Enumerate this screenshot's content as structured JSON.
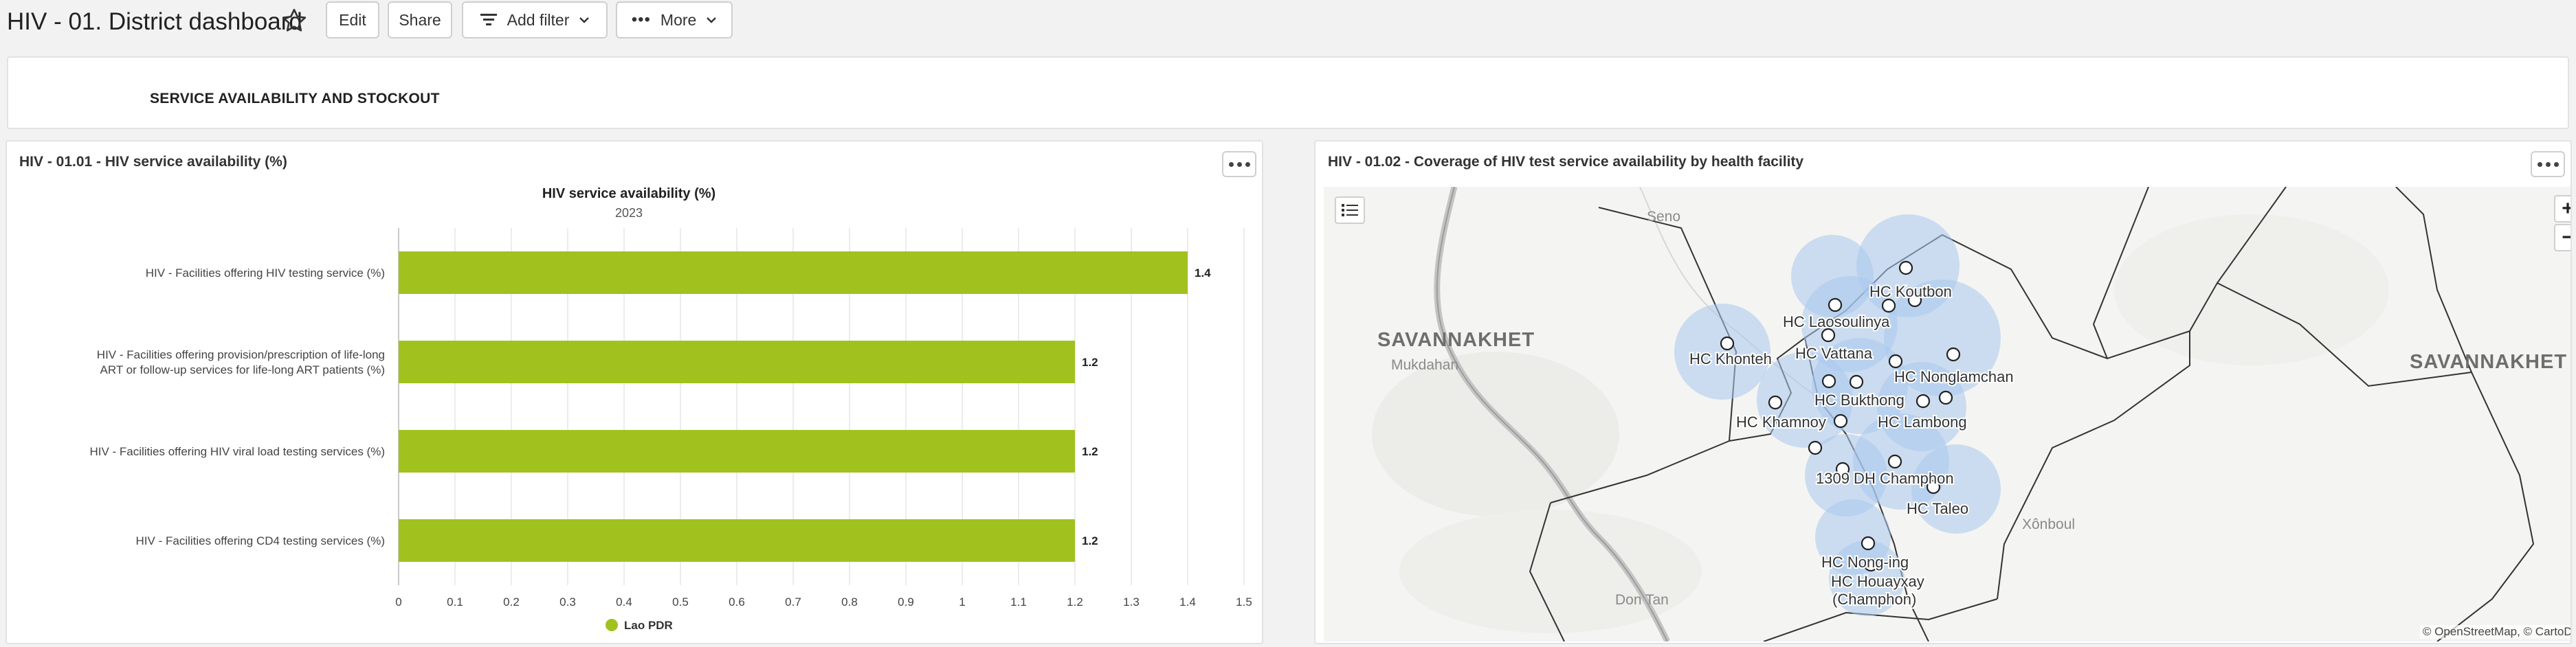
{
  "header": {
    "title": "HIV - 01. District dashboard",
    "edit_label": "Edit",
    "share_label": "Share",
    "add_filter_label": "Add filter",
    "more_label": "More"
  },
  "section": {
    "title": "SERVICE AVAILABILITY AND STOCKOUT"
  },
  "chart_card": {
    "title": "HIV - 01.01 - HIV service availability (%)"
  },
  "map_card": {
    "title": "HIV - 01.02 - Coverage of HIV test service availability by health facility",
    "attribution": "© OpenStreetMap, © CartoDB",
    "region_labels": [
      "SAVANNAKHET",
      "Mukdahan",
      "SAVANNAKHET",
      "Seno",
      "Xônboul",
      "Don Tan"
    ],
    "facility_labels": [
      "HC Koutbon",
      "HC Laosoulinya",
      "HC Khonteh",
      "HC Vattana",
      "HC Nonglamchan",
      "HC Bukthong",
      "HC Khamnoy",
      "HC Lambong",
      "1309 DH Champhon",
      "HC Taleo",
      "HC Nong-ing",
      "HC Houayxay",
      "(Champhon)"
    ],
    "zoom_in": "+",
    "zoom_out": "−"
  },
  "chart_data": {
    "type": "bar",
    "orientation": "horizontal",
    "title": "HIV service availability (%)",
    "subtitle": "2023",
    "categories": [
      "HIV - Facilities offering HIV testing service (%)",
      "HIV - Facilities offering provision/prescription of life-long ART or follow-up services for life-long ART patients (%)",
      "HIV - Facilities offering HIV viral load testing services (%)",
      "HIV - Facilities offering CD4 testing services (%)"
    ],
    "series": [
      {
        "name": "Lao PDR",
        "values": [
          1.4,
          1.2,
          1.2,
          1.2
        ],
        "color": "#a1c11f"
      }
    ],
    "xlim": [
      0,
      1.5
    ],
    "ticks": [
      "0",
      "0.1",
      "0.2",
      "0.3",
      "0.4",
      "0.5",
      "0.6",
      "0.7",
      "0.8",
      "0.9",
      "1",
      "1.1",
      "1.2",
      "1.3",
      "1.4",
      "1.5"
    ],
    "grid": true,
    "legend_position": "bottom-center"
  }
}
